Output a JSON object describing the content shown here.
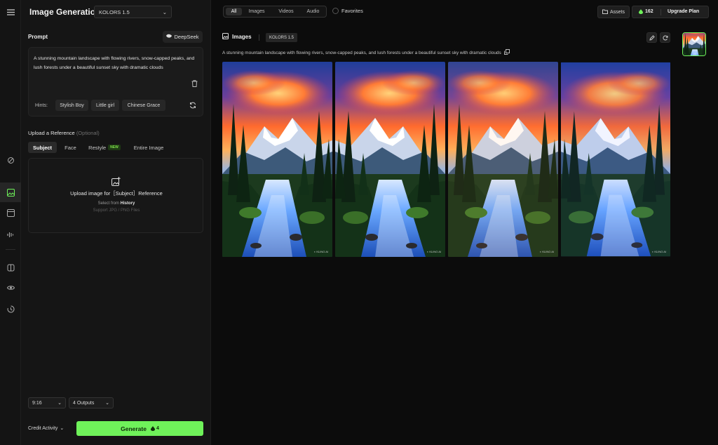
{
  "app": {
    "title": "Image Generation",
    "model": "KOLORS 1.5",
    "accent_color": "#6ff25a"
  },
  "rail": {
    "icons": [
      "menu-icon",
      "tools-icon",
      "image-icon",
      "video-icon",
      "audio-icon",
      "box-icon",
      "eye-icon",
      "history-icon"
    ],
    "active": "image-icon"
  },
  "prompt": {
    "label": "Prompt",
    "deepseek_label": "DeepSeek",
    "text": "A stunning mountain landscape with flowing rivers, snow-capped peaks, and lush forests under a beautiful sunset sky with dramatic clouds",
    "hints_label": "Hints:",
    "hints": [
      "Stylish Boy",
      "Little girl",
      "Chinese Grace"
    ]
  },
  "reference": {
    "label": "Upload a Reference",
    "optional": "(Optional)",
    "tabs": [
      "Subject",
      "Face",
      "Restyle",
      "Entire Image"
    ],
    "new_badge": "NEW",
    "active_tab": "Subject",
    "upload_title": "Upload image for［Subject］Reference",
    "history_prefix": "Select from",
    "history_link": "History",
    "support_text": "Support JPG / PNG Files"
  },
  "settings": {
    "aspect_ratio": "9:16",
    "outputs": "4 Outputs"
  },
  "footer": {
    "credit_activity": "Credit Activity",
    "generate_label": "Generate",
    "generate_cost": "4"
  },
  "topbar": {
    "filters": [
      "All",
      "Images",
      "Videos",
      "Audio"
    ],
    "active_filter": "All",
    "favorites": "Favorites",
    "assets": "Assets",
    "credits": "162",
    "upgrade": "Upgrade Plan"
  },
  "results": {
    "header": "Images",
    "model_badge": "KOLORS 1.5",
    "description": "A stunning mountain landscape with flowing rivers, snow-capped peaks, and lush forests under a beautiful sunset sky with dramatic clouds",
    "watermark": "KLING AI",
    "image_count": 4
  }
}
